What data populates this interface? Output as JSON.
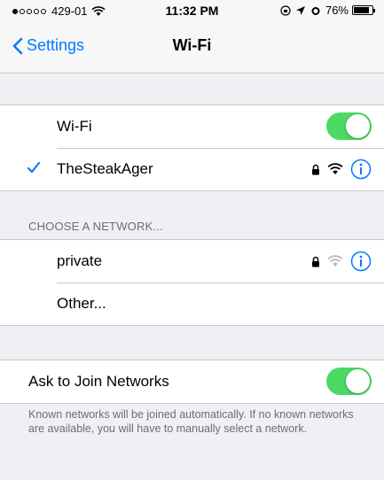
{
  "status_bar": {
    "carrier": "429-01",
    "time": "11:32 PM",
    "battery": "76%",
    "signal_bars": 1
  },
  "nav": {
    "back_label": "Settings",
    "title": "Wi-Fi"
  },
  "wifi": {
    "label": "Wi-Fi",
    "enabled": true,
    "connected_network": "TheSteakAger"
  },
  "networks": {
    "header": "CHOOSE A NETWORK...",
    "items": [
      {
        "name": "private",
        "secured": true
      },
      {
        "name": "Other..."
      }
    ]
  },
  "ask_to_join": {
    "label": "Ask to Join Networks",
    "enabled": true,
    "description": "Known networks will be joined automatically. If no known networks are available, you will have to manually select a network."
  },
  "colors": {
    "accent": "#007aff",
    "toggle_on": "#4cd964",
    "background": "#efeff4"
  }
}
